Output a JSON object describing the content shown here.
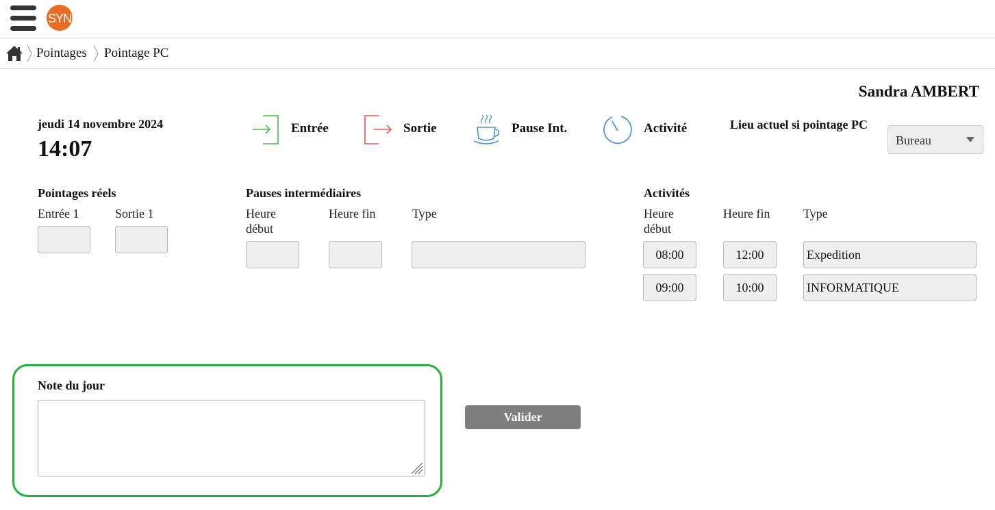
{
  "header": {
    "logo_text": "SYNEL",
    "brand_color": "#ea6b23"
  },
  "breadcrumb": {
    "items": [
      "Pointages",
      "Pointage PC"
    ]
  },
  "user": {
    "name": "Sandra AMBERT"
  },
  "clock": {
    "date": "jeudi 14 novembre 2024",
    "time": "14:07"
  },
  "actions": {
    "entree": {
      "label": "Entrée",
      "icon": "sign-in-icon",
      "color": "#4cb84c"
    },
    "sortie": {
      "label": "Sortie",
      "icon": "sign-out-icon",
      "color": "#e05a5a"
    },
    "pause": {
      "label": "Pause Int.",
      "icon": "coffee-cup-icon",
      "color": "#4a90d9"
    },
    "activite": {
      "label": "Activité",
      "icon": "timer-icon",
      "color": "#4a90d9"
    }
  },
  "lieu": {
    "label": "Lieu actuel si pointage PC",
    "selected": "Bureau"
  },
  "pointages": {
    "title": "Pointages réels",
    "col_entree": "Entrée 1",
    "col_sortie": "Sortie 1",
    "entree_value": "",
    "sortie_value": ""
  },
  "pauses": {
    "title": "Pauses intermédiaires",
    "col_debut": "Heure début",
    "col_fin": "Heure fin",
    "col_type": "Type",
    "debut_value": "",
    "fin_value": "",
    "type_value": ""
  },
  "activites": {
    "title": "Activités",
    "col_debut": "Heure début",
    "col_fin": "Heure fin",
    "col_type": "Type",
    "rows": [
      {
        "debut": "08:00",
        "fin": "12:00",
        "type": "Expedition"
      },
      {
        "debut": "09:00",
        "fin": "10:00",
        "type": "INFORMATIQUE"
      }
    ]
  },
  "note": {
    "label": "Note du jour",
    "value": "",
    "highlight_color": "#27b040"
  },
  "submit": {
    "label": "Valider"
  }
}
